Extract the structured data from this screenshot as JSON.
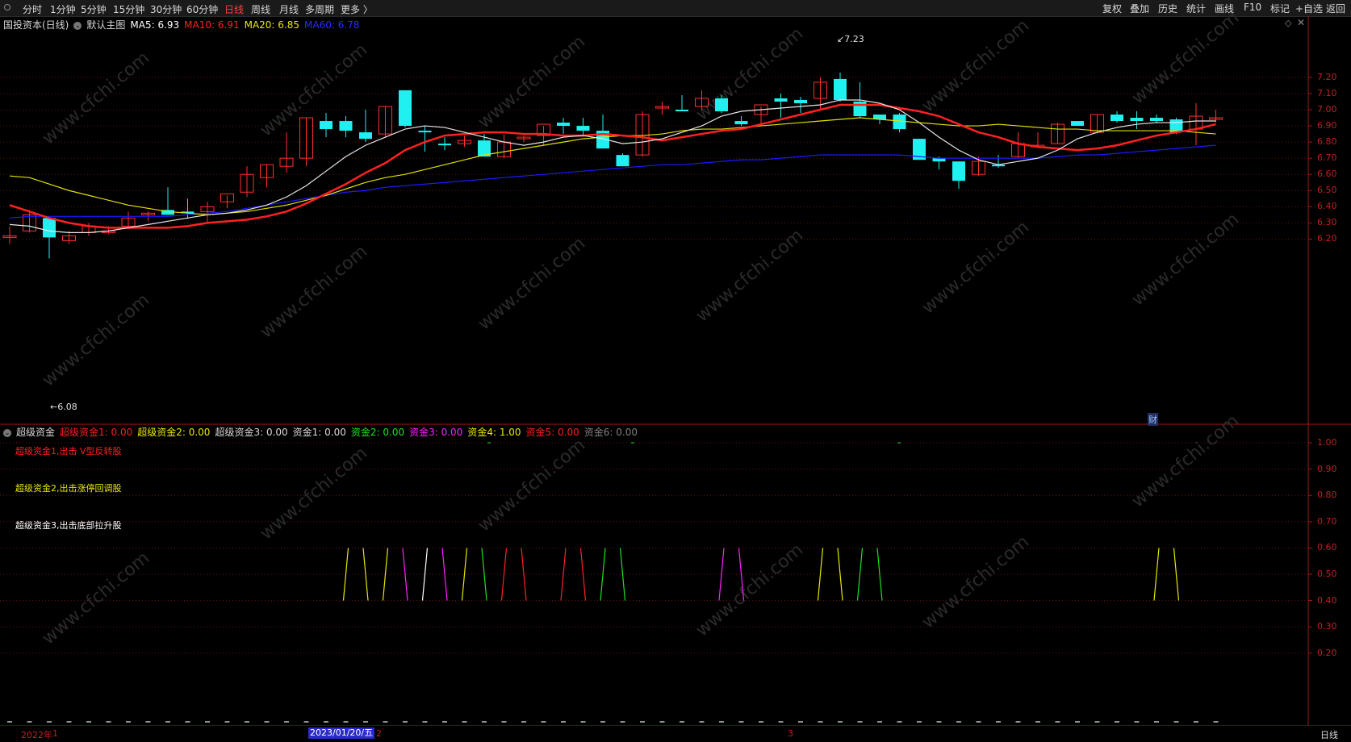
{
  "toolbar": {
    "periods": [
      "分时",
      "1分钟",
      "5分钟",
      "15分钟",
      "30分钟",
      "60分钟",
      "日线",
      "周线",
      "月线",
      "多周期",
      "更多 〉"
    ],
    "active": "日线",
    "right_buttons": [
      "复权",
      "叠加",
      "历史",
      "统计",
      "画线",
      "F10",
      "标记",
      "+自选",
      "返回"
    ]
  },
  "main_header": {
    "stock": "国投资本(日线)",
    "template": "默认主图",
    "ma5": "MA5: 6.93",
    "ma10": "MA10: 6.91",
    "ma20": "MA20: 6.85",
    "ma60": "MA60: 6.78",
    "colors": {
      "ma5": "#ffffff",
      "ma10": "#ff2020",
      "ma20": "#e8e800",
      "ma60": "#2020ff"
    }
  },
  "price_axis": [
    "7.20",
    "7.10",
    "7.00",
    "6.90",
    "6.80",
    "6.70",
    "6.60",
    "6.50",
    "6.40",
    "6.30",
    "6.20"
  ],
  "high_label": "7.23",
  "low_label": "6.08",
  "fin_marker": "财",
  "sub_header": {
    "name": "超级资金",
    "items": [
      {
        "label": "超级资金1: 0.00",
        "color": "#ff2020"
      },
      {
        "label": "超级资金2: 0.00",
        "color": "#e8e800"
      },
      {
        "label": "超级资金3: 0.00",
        "color": "#d8d8d8"
      },
      {
        "label": "资金1: 0.00",
        "color": "#d8d8d8"
      },
      {
        "label": "资金2: 0.00",
        "color": "#20e020"
      },
      {
        "label": "资金3: 0.00",
        "color": "#ff20ff"
      },
      {
        "label": "资金4: 1.00",
        "color": "#e8e800"
      },
      {
        "label": "资金5: 0.00",
        "color": "#ff2020"
      },
      {
        "label": "资金6: 0.00",
        "color": "#808080"
      }
    ]
  },
  "notes": [
    {
      "text": "超级资金1,出击 V型反转股",
      "color": "#ff2020"
    },
    {
      "text": "超级资金2,出击涨停回调股",
      "color": "#e8e800"
    },
    {
      "text": "超级资金3,出击底部拉升股",
      "color": "#ffffff"
    }
  ],
  "sub_axis": [
    "1.00",
    "0.90",
    "0.80",
    "0.70",
    "0.60",
    "0.50",
    "0.40",
    "0.30",
    "0.20"
  ],
  "bottom": {
    "year": "2022年",
    "m1": "1",
    "date": "2023/01/20/五",
    "m2": "2",
    "m3": "3",
    "period": "日线"
  },
  "watermark": "www.cfchi.com",
  "chart_data": {
    "type": "candlestick",
    "ohlc": [
      [
        6.21,
        6.28,
        6.17,
        6.22
      ],
      [
        6.25,
        6.38,
        6.24,
        6.35
      ],
      [
        6.33,
        6.33,
        6.08,
        6.21
      ],
      [
        6.19,
        6.25,
        6.17,
        6.22
      ],
      [
        6.24,
        6.3,
        6.22,
        6.28
      ],
      [
        6.25,
        6.28,
        6.23,
        6.25
      ],
      [
        6.28,
        6.37,
        6.26,
        6.33
      ],
      [
        6.35,
        6.37,
        6.31,
        6.36
      ],
      [
        6.38,
        6.52,
        6.35,
        6.35
      ],
      [
        6.37,
        6.45,
        6.33,
        6.36
      ],
      [
        6.37,
        6.43,
        6.3,
        6.4
      ],
      [
        6.43,
        6.47,
        6.39,
        6.48
      ],
      [
        6.49,
        6.65,
        6.46,
        6.6
      ],
      [
        6.58,
        6.66,
        6.52,
        6.66
      ],
      [
        6.65,
        6.86,
        6.61,
        6.7
      ],
      [
        6.7,
        6.95,
        6.65,
        6.95
      ],
      [
        6.93,
        6.98,
        6.83,
        6.88
      ],
      [
        6.93,
        6.96,
        6.83,
        6.87
      ],
      [
        6.86,
        7.0,
        6.8,
        6.82
      ],
      [
        6.85,
        7.02,
        6.83,
        7.02
      ],
      [
        7.12,
        7.12,
        6.89,
        6.9
      ],
      [
        6.87,
        6.9,
        6.74,
        6.86
      ],
      [
        6.79,
        6.83,
        6.75,
        6.78
      ],
      [
        6.79,
        6.84,
        6.77,
        6.81
      ],
      [
        6.81,
        6.85,
        6.71,
        6.71
      ],
      [
        6.71,
        6.85,
        6.7,
        6.8
      ],
      [
        6.82,
        6.84,
        6.8,
        6.83
      ],
      [
        6.84,
        6.9,
        6.78,
        6.91
      ],
      [
        6.92,
        6.95,
        6.85,
        6.9
      ],
      [
        6.9,
        6.95,
        6.84,
        6.87
      ],
      [
        6.87,
        6.97,
        6.8,
        6.76
      ],
      [
        6.72,
        6.73,
        6.65,
        6.65
      ],
      [
        6.72,
        6.99,
        6.71,
        6.97
      ],
      [
        7.01,
        7.05,
        6.97,
        7.02
      ],
      [
        7.0,
        7.09,
        6.99,
        6.99
      ],
      [
        7.02,
        7.12,
        7.0,
        7.07
      ],
      [
        7.07,
        7.09,
        6.98,
        6.99
      ],
      [
        6.93,
        6.96,
        6.9,
        6.91
      ],
      [
        6.97,
        7.02,
        6.91,
        7.03
      ],
      [
        7.07,
        7.1,
        6.95,
        7.05
      ],
      [
        7.06,
        7.08,
        6.98,
        7.04
      ],
      [
        7.07,
        7.2,
        7.0,
        7.17
      ],
      [
        7.19,
        7.23,
        7.05,
        7.06
      ],
      [
        7.05,
        7.17,
        6.95,
        6.96
      ],
      [
        6.97,
        6.97,
        6.91,
        6.94
      ],
      [
        6.97,
        6.98,
        6.86,
        6.88
      ],
      [
        6.82,
        6.82,
        6.69,
        6.69
      ],
      [
        6.7,
        6.71,
        6.63,
        6.68
      ],
      [
        6.68,
        6.68,
        6.51,
        6.56
      ],
      [
        6.6,
        6.71,
        6.59,
        6.68
      ],
      [
        6.66,
        6.72,
        6.64,
        6.65
      ],
      [
        6.71,
        6.86,
        6.7,
        6.79
      ],
      [
        6.77,
        6.86,
        6.77,
        6.78
      ],
      [
        6.79,
        6.92,
        6.79,
        6.91
      ],
      [
        6.93,
        6.93,
        6.9,
        6.9
      ],
      [
        6.86,
        6.97,
        6.85,
        6.97
      ],
      [
        6.97,
        6.99,
        6.92,
        6.93
      ],
      [
        6.95,
        6.99,
        6.88,
        6.93
      ],
      [
        6.95,
        6.97,
        6.92,
        6.93
      ],
      [
        6.94,
        6.95,
        6.85,
        6.86
      ],
      [
        6.88,
        7.04,
        6.78,
        6.96
      ],
      [
        6.94,
        7.0,
        6.92,
        6.95
      ]
    ],
    "ma5": [
      6.29,
      6.28,
      6.25,
      6.24,
      6.24,
      6.25,
      6.27,
      6.29,
      6.31,
      6.33,
      6.35,
      6.36,
      6.38,
      6.41,
      6.46,
      6.53,
      6.62,
      6.71,
      6.78,
      6.83,
      6.88,
      6.9,
      6.89,
      6.86,
      6.83,
      6.8,
      6.78,
      6.8,
      6.83,
      6.84,
      6.82,
      6.79,
      6.8,
      6.82,
      6.86,
      6.9,
      6.96,
      6.99,
      7.0,
      7.01,
      7.02,
      7.03,
      7.06,
      7.06,
      7.04,
      7.0,
      6.92,
      6.83,
      6.75,
      6.69,
      6.66,
      6.68,
      6.7,
      6.75,
      6.82,
      6.86,
      6.89,
      6.91,
      6.92,
      6.92,
      6.93,
      6.93
    ],
    "ma10": [
      6.41,
      6.37,
      6.33,
      6.3,
      6.28,
      6.27,
      6.27,
      6.27,
      6.27,
      6.28,
      6.3,
      6.31,
      6.32,
      6.34,
      6.37,
      6.42,
      6.48,
      6.54,
      6.61,
      6.67,
      6.75,
      6.8,
      6.84,
      6.85,
      6.86,
      6.86,
      6.85,
      6.85,
      6.84,
      6.84,
      6.85,
      6.84,
      6.83,
      6.81,
      6.83,
      6.85,
      6.87,
      6.88,
      6.91,
      6.94,
      6.97,
      7.0,
      7.03,
      7.03,
      7.03,
      7.01,
      6.99,
      6.96,
      6.91,
      6.86,
      6.83,
      6.79,
      6.77,
      6.76,
      6.75,
      6.76,
      6.78,
      6.81,
      6.84,
      6.86,
      6.88,
      6.91
    ],
    "ma20": [
      6.59,
      6.58,
      6.54,
      6.5,
      6.47,
      6.44,
      6.41,
      6.39,
      6.37,
      6.36,
      6.35,
      6.36,
      6.37,
      6.39,
      6.41,
      6.44,
      6.47,
      6.51,
      6.55,
      6.58,
      6.6,
      6.63,
      6.66,
      6.69,
      6.72,
      6.74,
      6.76,
      6.78,
      6.8,
      6.82,
      6.83,
      6.84,
      6.84,
      6.85,
      6.87,
      6.88,
      6.88,
      6.89,
      6.9,
      6.91,
      6.92,
      6.93,
      6.94,
      6.95,
      6.94,
      6.93,
      6.92,
      6.91,
      6.9,
      6.9,
      6.91,
      6.9,
      6.89,
      6.88,
      6.88,
      6.87,
      6.87,
      6.87,
      6.87,
      6.87,
      6.86,
      6.85
    ],
    "ma60": [
      6.33,
      6.34,
      6.34,
      6.34,
      6.34,
      6.34,
      6.34,
      6.34,
      6.34,
      6.35,
      6.36,
      6.37,
      6.39,
      6.41,
      6.43,
      6.45,
      6.47,
      6.49,
      6.5,
      6.52,
      6.53,
      6.54,
      6.55,
      6.56,
      6.57,
      6.58,
      6.59,
      6.6,
      6.61,
      6.62,
      6.63,
      6.64,
      6.65,
      6.66,
      6.66,
      6.67,
      6.68,
      6.69,
      6.69,
      6.7,
      6.71,
      6.72,
      6.72,
      6.72,
      6.72,
      6.72,
      6.71,
      6.7,
      6.7,
      6.7,
      6.7,
      6.7,
      6.7,
      6.71,
      6.72,
      6.72,
      6.73,
      6.74,
      6.75,
      6.76,
      6.77,
      6.78
    ],
    "signals": [
      {
        "i": 17,
        "color": "#e8e800"
      },
      {
        "i": 18,
        "color": "#e8e800"
      },
      {
        "i": 19,
        "color": "#e8e800"
      },
      {
        "i": 20,
        "color": "#ff20ff"
      },
      {
        "i": 21,
        "color": "#ffffff"
      },
      {
        "i": 22,
        "color": "#ff20ff"
      },
      {
        "i": 23,
        "color": "#e8e800"
      },
      {
        "i": 24,
        "color": "#20e020"
      },
      {
        "i": 25,
        "color": "#ff2020"
      },
      {
        "i": 26,
        "color": "#ff2020"
      },
      {
        "i": 28,
        "color": "#ff2020"
      },
      {
        "i": 29,
        "color": "#ff2020"
      },
      {
        "i": 30,
        "color": "#20e020"
      },
      {
        "i": 31,
        "color": "#20e020"
      },
      {
        "i": 36,
        "color": "#ff20ff"
      },
      {
        "i": 37,
        "color": "#ff20ff"
      },
      {
        "i": 41,
        "color": "#e8e800"
      },
      {
        "i": 42,
        "color": "#e8e800"
      },
      {
        "i": 43,
        "color": "#20e020"
      },
      {
        "i": 44,
        "color": "#20e020"
      },
      {
        "i": 58,
        "color": "#e8e800"
      },
      {
        "i": 59,
        "color": "#e8e800"
      }
    ]
  }
}
